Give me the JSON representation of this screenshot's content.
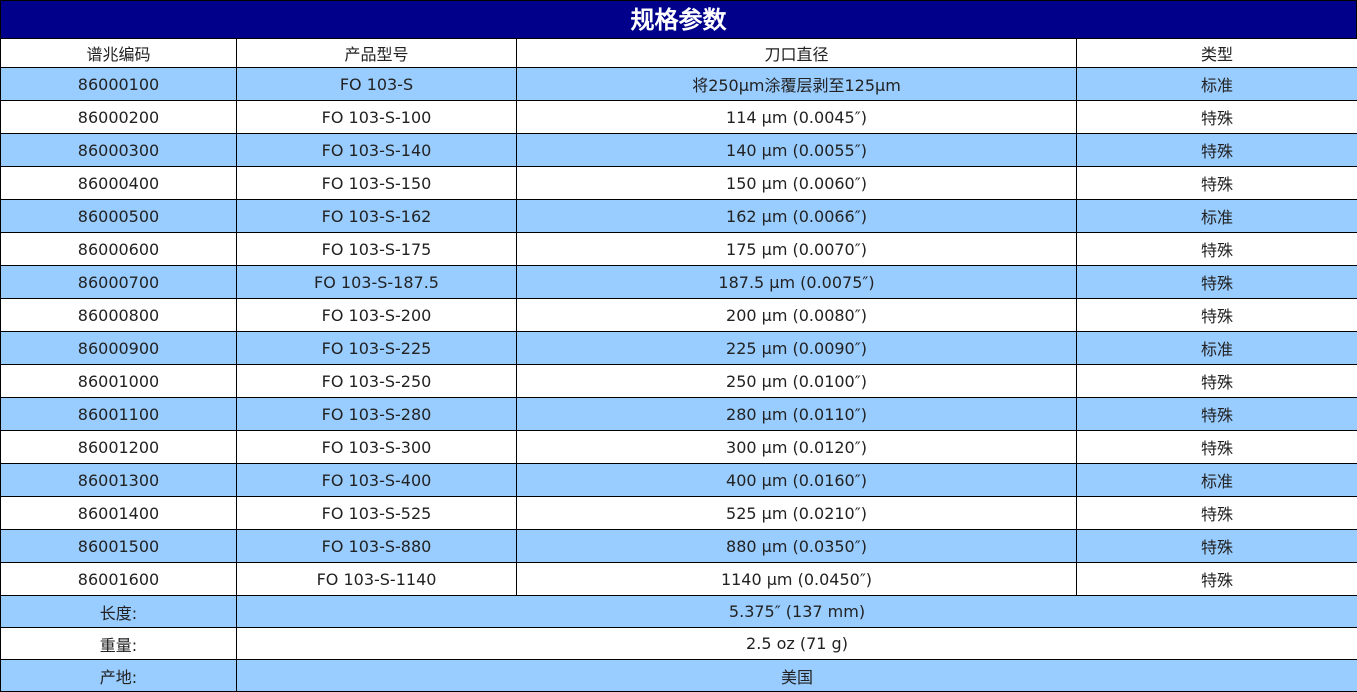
{
  "title": "规格参数",
  "headers": [
    "谱兆编码",
    "产品型号",
    "刀口直径",
    "类型"
  ],
  "rows": [
    {
      "code": "86000100",
      "model": "FO 103-S",
      "diameter": "将250µm涂覆层剥至125µm",
      "type": "标准"
    },
    {
      "code": "86000200",
      "model": "FO 103-S-100",
      "diameter": "114 µm (0.0045″)",
      "type": "特殊"
    },
    {
      "code": "86000300",
      "model": "FO 103-S-140",
      "diameter": "140 µm (0.0055″)",
      "type": "特殊"
    },
    {
      "code": "86000400",
      "model": "FO 103-S-150",
      "diameter": "150 µm (0.0060″)",
      "type": "特殊"
    },
    {
      "code": "86000500",
      "model": "FO 103-S-162",
      "diameter": "162 µm (0.0066″)",
      "type": "标准"
    },
    {
      "code": "86000600",
      "model": "FO 103-S-175",
      "diameter": "175 µm (0.0070″)",
      "type": "特殊"
    },
    {
      "code": "86000700",
      "model": "FO 103-S-187.5",
      "diameter": "187.5 µm (0.0075″)",
      "type": "特殊"
    },
    {
      "code": "86000800",
      "model": "FO 103-S-200",
      "diameter": "200 µm (0.0080″)",
      "type": "特殊"
    },
    {
      "code": "86000900",
      "model": "FO 103-S-225",
      "diameter": "225 µm (0.0090″)",
      "type": "标准"
    },
    {
      "code": "86001000",
      "model": "FO 103-S-250",
      "diameter": "250 µm (0.0100″)",
      "type": "特殊"
    },
    {
      "code": "86001100",
      "model": "FO 103-S-280",
      "diameter": "280 µm (0.0110″)",
      "type": "特殊"
    },
    {
      "code": "86001200",
      "model": "FO 103-S-300",
      "diameter": "300 µm (0.0120″)",
      "type": "特殊"
    },
    {
      "code": "86001300",
      "model": "FO 103-S-400",
      "diameter": "400 µm (0.0160″)",
      "type": "标准"
    },
    {
      "code": "86001400",
      "model": "FO 103-S-525",
      "diameter": "525 µm (0.0210″)",
      "type": "特殊"
    },
    {
      "code": "86001500",
      "model": "FO 103-S-880",
      "diameter": "880 µm (0.0350″)",
      "type": "特殊"
    },
    {
      "code": "86001600",
      "model": "FO 103-S-1140",
      "diameter": "1140 µm (0.0450″)",
      "type": "特殊"
    }
  ],
  "footer": [
    {
      "label": "长度:",
      "value": "5.375″ (137 mm)"
    },
    {
      "label": "重量:",
      "value": "2.5 oz (71 g)"
    },
    {
      "label": "产地:",
      "value": "美国"
    }
  ],
  "colors": {
    "title_bg": "#00008b",
    "row_blue": "#99ccff",
    "row_white": "#ffffff"
  }
}
